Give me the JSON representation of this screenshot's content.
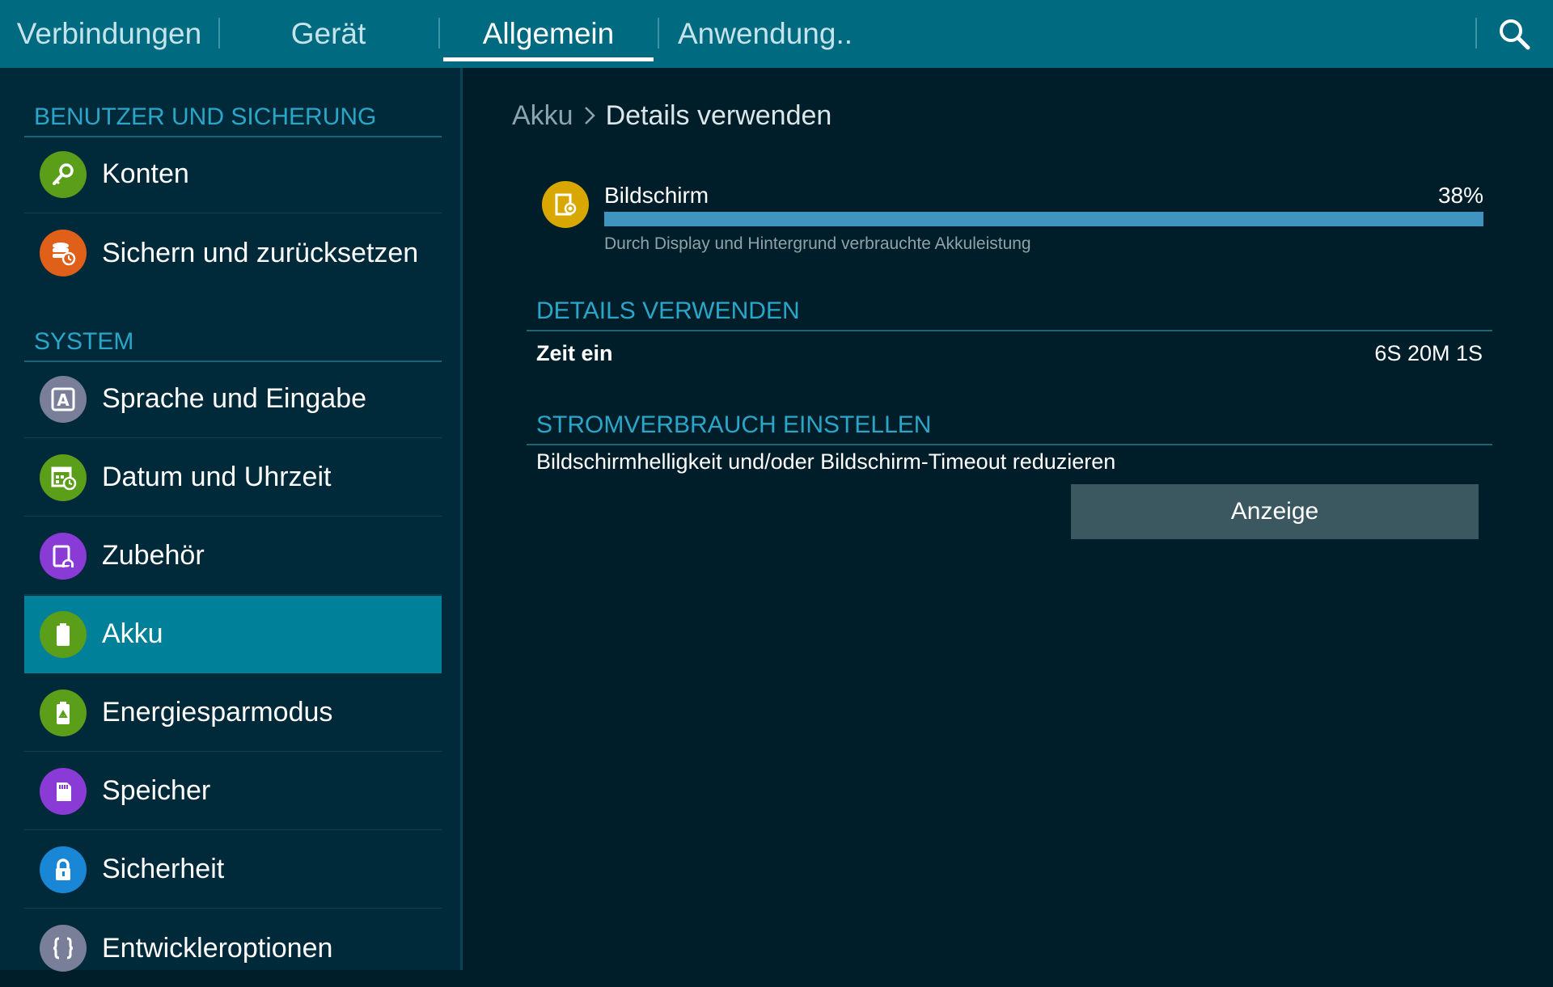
{
  "tabs": [
    {
      "label": "Verbindungen",
      "active": false
    },
    {
      "label": "Gerät",
      "active": false
    },
    {
      "label": "Allgemein",
      "active": true
    },
    {
      "label": "Anwendung..",
      "active": false
    }
  ],
  "search": {
    "icon": "search-icon"
  },
  "sidebar": {
    "sections": [
      {
        "title": "BENUTZER UND SICHERUNG",
        "items": [
          {
            "label": "Konten",
            "icon": "key-icon",
            "color": "#5a9e1a"
          },
          {
            "label": "Sichern und zurücksetzen",
            "icon": "backup-icon",
            "color": "#e0601a"
          }
        ]
      },
      {
        "title": "SYSTEM",
        "items": [
          {
            "label": "Sprache und Eingabe",
            "icon": "language-icon",
            "color": "#7a7f99"
          },
          {
            "label": "Datum und Uhrzeit",
            "icon": "calendar-clock-icon",
            "color": "#5a9e1a"
          },
          {
            "label": "Zubehör",
            "icon": "accessory-icon",
            "color": "#8a3bd6"
          },
          {
            "label": "Akku",
            "icon": "battery-icon",
            "color": "#5a9e1a",
            "selected": true
          },
          {
            "label": "Energiesparmodus",
            "icon": "power-saving-icon",
            "color": "#5a9e1a"
          },
          {
            "label": "Speicher",
            "icon": "storage-icon",
            "color": "#8a3bd6"
          },
          {
            "label": "Sicherheit",
            "icon": "lock-icon",
            "color": "#1a86d6"
          },
          {
            "label": "Entwickleroptionen",
            "icon": "developer-braces-icon",
            "color": "#7a7f99"
          }
        ]
      }
    ]
  },
  "breadcrumb": {
    "parent": "Akku",
    "current": "Details verwenden"
  },
  "usage": {
    "name": "Bildschirm",
    "percent_text": "38%",
    "fraction": 1.0,
    "description": "Durch Display und Hintergrund verbrauchte Akkuleistung",
    "icon": "screen-brightness-icon",
    "color": "#d9a800"
  },
  "details": {
    "header": "DETAILS VERWENDEN",
    "label": "Zeit ein",
    "value": "6S 20M 1S"
  },
  "power": {
    "header": "STROMVERBRAUCH EINSTELLEN",
    "tip": "Bildschirmhelligkeit und/oder Bildschirm-Timeout reduzieren",
    "button_label": "Anzeige"
  },
  "colors": {
    "topbar": "#006a80",
    "sidebar": "#002a3a",
    "content": "#001e2a",
    "accent": "#2aa6c8",
    "selected": "#008099",
    "bar": "#3f94c0"
  }
}
